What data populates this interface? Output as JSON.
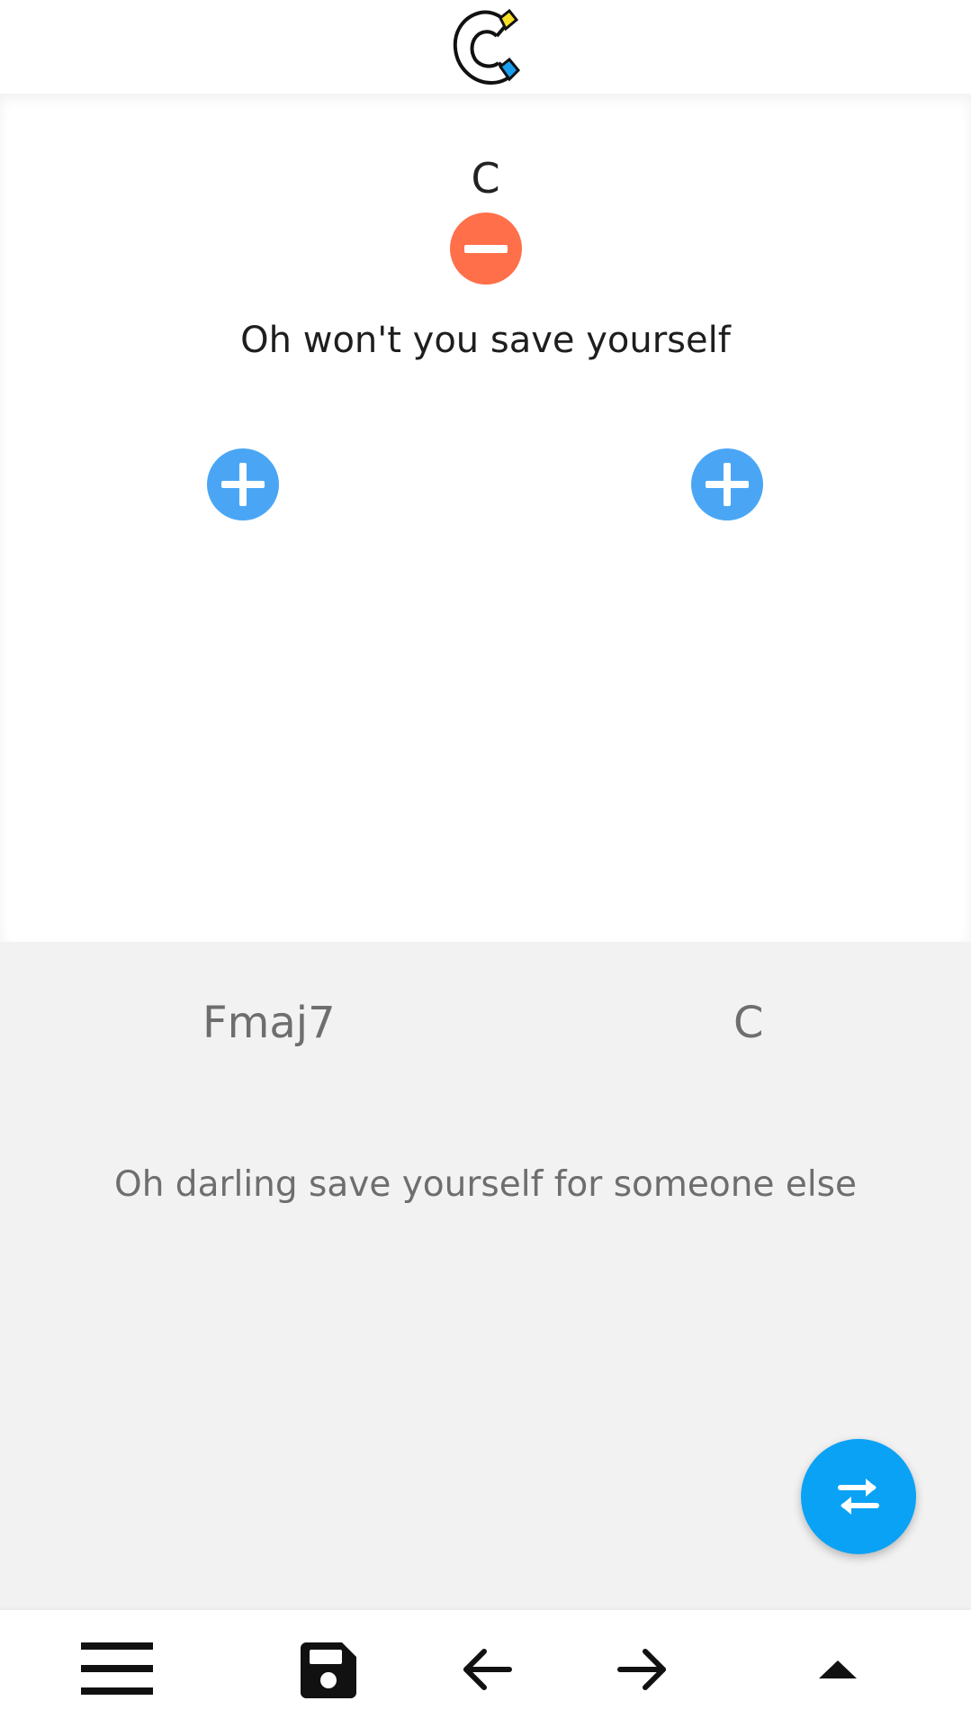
{
  "app": {
    "logo_icon": "chordpro-c-logo-icon",
    "colors": {
      "remove": "#ff6f4a",
      "add": "#4aa6f5",
      "fab": "#0aa2f5",
      "active_bg": "#ffffff",
      "next_bg": "#f2f2f2"
    }
  },
  "active_line": {
    "chord": "C",
    "lyric": "Oh won't you save yourself",
    "remove_icon": "minus-circle-icon",
    "add_icon": "plus-circle-icon"
  },
  "next_line": {
    "chords": [
      "Fmaj7",
      "C"
    ],
    "lyric": "Oh darling save yourself for someone else"
  },
  "fab": {
    "icon": "swap-arrows-icon"
  },
  "toolbar": {
    "icons": [
      "menu-icon",
      "save-icon",
      "arrow-left-icon",
      "arrow-right-icon",
      "caret-up-icon"
    ]
  }
}
